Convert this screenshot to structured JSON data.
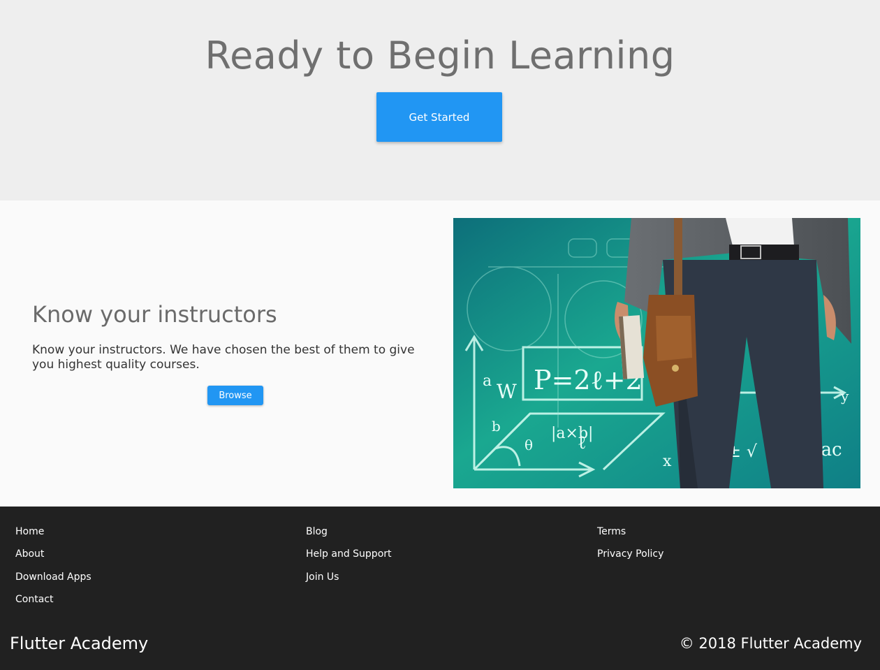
{
  "hero": {
    "title": "Ready to Begin Learning",
    "cta_label": "Get Started"
  },
  "feature": {
    "title": "Know your instructors",
    "text": "Know your instructors. We have chosen the best of them to give you highest quality courses.",
    "button_label": "Browse",
    "image": {
      "description_icon": "instructor-photo",
      "board_formula": "P=2ℓ+2",
      "board_labels": [
        "a",
        "b",
        "W",
        "θ",
        "|a×b|",
        "ℓ",
        "4ac",
        "x",
        "y",
        "± √"
      ]
    }
  },
  "footer": {
    "columns": [
      {
        "links": [
          "Home",
          "About",
          "Download Apps",
          "Contact"
        ]
      },
      {
        "links": [
          "Blog",
          "Help and Support",
          "Join Us"
        ]
      },
      {
        "links": [
          "Terms",
          "Privacy Policy"
        ]
      }
    ],
    "brand": "Flutter Academy",
    "copyright": "© 2018 Flutter Academy"
  },
  "colors": {
    "accent": "#2196f3",
    "hero_bg": "#eeeeee",
    "footer_bg": "#212121",
    "board_teal": "#1aa890"
  }
}
